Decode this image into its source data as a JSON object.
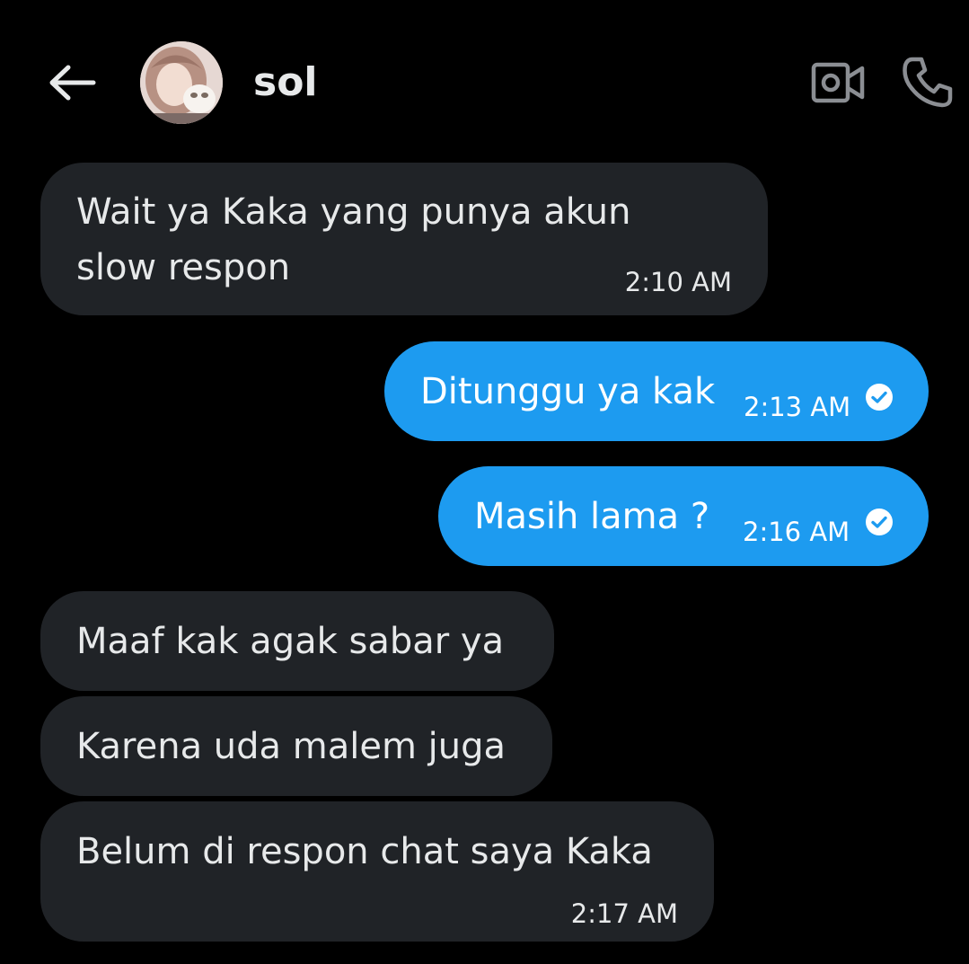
{
  "header": {
    "contact_name": "sol",
    "back_icon": "arrow-left-icon",
    "video_icon": "video-camera-icon",
    "call_icon": "phone-icon"
  },
  "colors": {
    "background": "#000000",
    "incoming_bubble": "#202327",
    "outgoing_bubble": "#1d9bf0",
    "text": "#e7e9ea"
  },
  "messages": [
    {
      "direction": "in",
      "lines": [
        "Wait ya Kaka yang punya akun",
        "slow respon"
      ],
      "time": "2:10 AM"
    },
    {
      "direction": "out",
      "text": "Ditunggu ya kak",
      "time": "2:13 AM",
      "status_icon": "check-circle-icon"
    },
    {
      "direction": "out",
      "text": "Masih lama ?",
      "time": "2:16 AM",
      "status_icon": "check-circle-icon"
    },
    {
      "direction": "in",
      "text": "Maaf kak agak sabar ya"
    },
    {
      "direction": "in",
      "text": "Karena uda malem juga"
    },
    {
      "direction": "in",
      "text": "Belum di respon chat saya Kaka",
      "time": "2:17 AM"
    }
  ]
}
